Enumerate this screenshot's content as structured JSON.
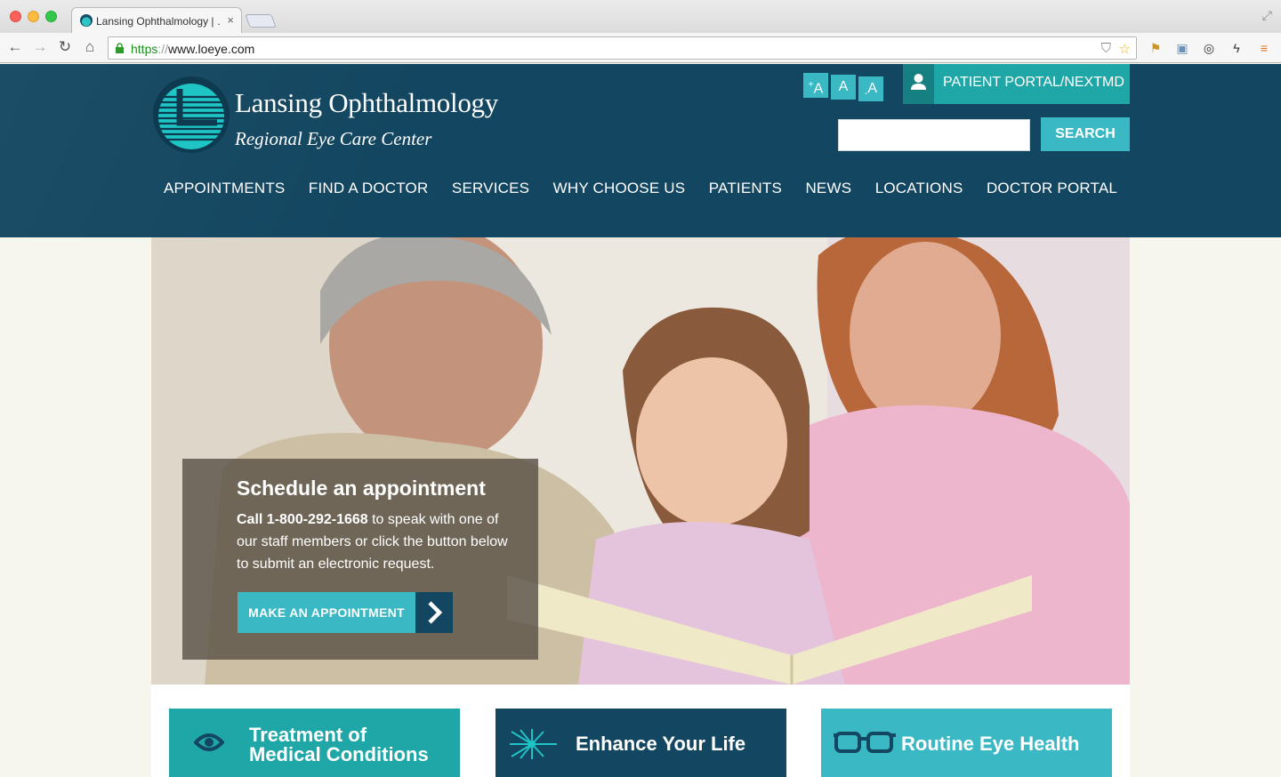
{
  "browser": {
    "tab_title": "Lansing Ophthalmology | …",
    "tab_close": "×",
    "url_scheme": "https",
    "url_sep": "://",
    "url_host": "www.loeye.com"
  },
  "header": {
    "logo_title": "Lansing Ophthalmology",
    "logo_subtitle": "Regional Eye Care Center",
    "font_increase": "A",
    "font_normal": "A",
    "font_decrease": "A",
    "portal_label": "PATIENT PORTAL/NEXTMD",
    "search_value": "",
    "search_button": "SEARCH"
  },
  "nav": {
    "items": [
      "APPOINTMENTS",
      "FIND A DOCTOR",
      "SERVICES",
      "WHY CHOOSE US",
      "PATIENTS",
      "NEWS",
      "LOCATIONS",
      "DOCTOR PORTAL"
    ]
  },
  "hero": {
    "title": "Schedule an appointment",
    "phone_bold": "Call 1-800-292-1668",
    "text_rest": " to speak with one of our staff members or click the button below to submit an electronic request.",
    "button_label": "MAKE AN APPOINTMENT"
  },
  "tiles": [
    {
      "line1": "Treatment of",
      "line2": "Medical Conditions",
      "icon": "eye-icon"
    },
    {
      "label": "Enhance Your Life",
      "icon": "laser-burst-icon"
    },
    {
      "label": "Routine Eye Health",
      "icon": "glasses-icon"
    }
  ],
  "colors": {
    "header_bg": "#134660",
    "accent_teal": "#3ab8c4",
    "accent_green_teal": "#1fa7a7",
    "page_bg": "#f6f5ee"
  }
}
